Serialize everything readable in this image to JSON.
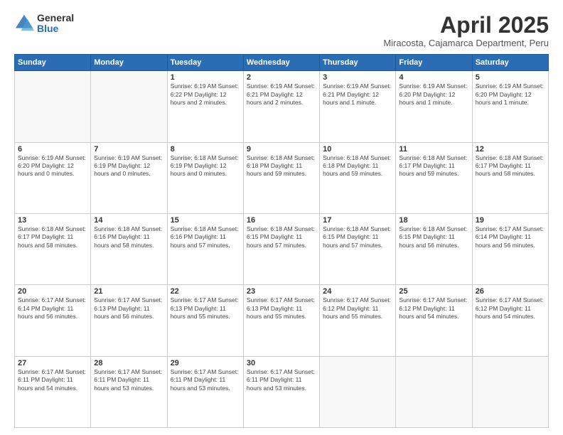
{
  "logo": {
    "general": "General",
    "blue": "Blue"
  },
  "title": "April 2025",
  "location": "Miracosta, Cajamarca Department, Peru",
  "days_of_week": [
    "Sunday",
    "Monday",
    "Tuesday",
    "Wednesday",
    "Thursday",
    "Friday",
    "Saturday"
  ],
  "weeks": [
    [
      {
        "day": "",
        "info": ""
      },
      {
        "day": "",
        "info": ""
      },
      {
        "day": "1",
        "info": "Sunrise: 6:19 AM\nSunset: 6:22 PM\nDaylight: 12 hours and 2 minutes."
      },
      {
        "day": "2",
        "info": "Sunrise: 6:19 AM\nSunset: 6:21 PM\nDaylight: 12 hours and 2 minutes."
      },
      {
        "day": "3",
        "info": "Sunrise: 6:19 AM\nSunset: 6:21 PM\nDaylight: 12 hours and 1 minute."
      },
      {
        "day": "4",
        "info": "Sunrise: 6:19 AM\nSunset: 6:20 PM\nDaylight: 12 hours and 1 minute."
      },
      {
        "day": "5",
        "info": "Sunrise: 6:19 AM\nSunset: 6:20 PM\nDaylight: 12 hours and 1 minute."
      }
    ],
    [
      {
        "day": "6",
        "info": "Sunrise: 6:19 AM\nSunset: 6:20 PM\nDaylight: 12 hours and 0 minutes."
      },
      {
        "day": "7",
        "info": "Sunrise: 6:19 AM\nSunset: 6:19 PM\nDaylight: 12 hours and 0 minutes."
      },
      {
        "day": "8",
        "info": "Sunrise: 6:18 AM\nSunset: 6:19 PM\nDaylight: 12 hours and 0 minutes."
      },
      {
        "day": "9",
        "info": "Sunrise: 6:18 AM\nSunset: 6:18 PM\nDaylight: 11 hours and 59 minutes."
      },
      {
        "day": "10",
        "info": "Sunrise: 6:18 AM\nSunset: 6:18 PM\nDaylight: 11 hours and 59 minutes."
      },
      {
        "day": "11",
        "info": "Sunrise: 6:18 AM\nSunset: 6:17 PM\nDaylight: 11 hours and 59 minutes."
      },
      {
        "day": "12",
        "info": "Sunrise: 6:18 AM\nSunset: 6:17 PM\nDaylight: 11 hours and 58 minutes."
      }
    ],
    [
      {
        "day": "13",
        "info": "Sunrise: 6:18 AM\nSunset: 6:17 PM\nDaylight: 11 hours and 58 minutes."
      },
      {
        "day": "14",
        "info": "Sunrise: 6:18 AM\nSunset: 6:16 PM\nDaylight: 11 hours and 58 minutes."
      },
      {
        "day": "15",
        "info": "Sunrise: 6:18 AM\nSunset: 6:16 PM\nDaylight: 11 hours and 57 minutes."
      },
      {
        "day": "16",
        "info": "Sunrise: 6:18 AM\nSunset: 6:15 PM\nDaylight: 11 hours and 57 minutes."
      },
      {
        "day": "17",
        "info": "Sunrise: 6:18 AM\nSunset: 6:15 PM\nDaylight: 11 hours and 57 minutes."
      },
      {
        "day": "18",
        "info": "Sunrise: 6:18 AM\nSunset: 6:15 PM\nDaylight: 11 hours and 56 minutes."
      },
      {
        "day": "19",
        "info": "Sunrise: 6:17 AM\nSunset: 6:14 PM\nDaylight: 11 hours and 56 minutes."
      }
    ],
    [
      {
        "day": "20",
        "info": "Sunrise: 6:17 AM\nSunset: 6:14 PM\nDaylight: 11 hours and 56 minutes."
      },
      {
        "day": "21",
        "info": "Sunrise: 6:17 AM\nSunset: 6:13 PM\nDaylight: 11 hours and 56 minutes."
      },
      {
        "day": "22",
        "info": "Sunrise: 6:17 AM\nSunset: 6:13 PM\nDaylight: 11 hours and 55 minutes."
      },
      {
        "day": "23",
        "info": "Sunrise: 6:17 AM\nSunset: 6:13 PM\nDaylight: 11 hours and 55 minutes."
      },
      {
        "day": "24",
        "info": "Sunrise: 6:17 AM\nSunset: 6:12 PM\nDaylight: 11 hours and 55 minutes."
      },
      {
        "day": "25",
        "info": "Sunrise: 6:17 AM\nSunset: 6:12 PM\nDaylight: 11 hours and 54 minutes."
      },
      {
        "day": "26",
        "info": "Sunrise: 6:17 AM\nSunset: 6:12 PM\nDaylight: 11 hours and 54 minutes."
      }
    ],
    [
      {
        "day": "27",
        "info": "Sunrise: 6:17 AM\nSunset: 6:11 PM\nDaylight: 11 hours and 54 minutes."
      },
      {
        "day": "28",
        "info": "Sunrise: 6:17 AM\nSunset: 6:11 PM\nDaylight: 11 hours and 53 minutes."
      },
      {
        "day": "29",
        "info": "Sunrise: 6:17 AM\nSunset: 6:11 PM\nDaylight: 11 hours and 53 minutes."
      },
      {
        "day": "30",
        "info": "Sunrise: 6:17 AM\nSunset: 6:11 PM\nDaylight: 11 hours and 53 minutes."
      },
      {
        "day": "",
        "info": ""
      },
      {
        "day": "",
        "info": ""
      },
      {
        "day": "",
        "info": ""
      }
    ]
  ]
}
